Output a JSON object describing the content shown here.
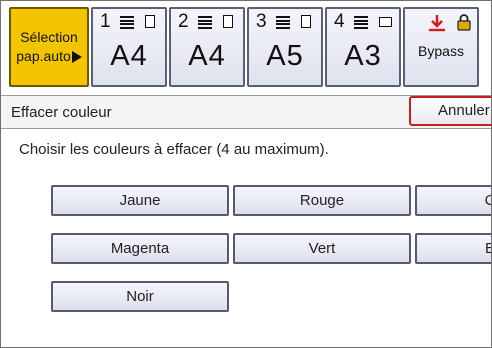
{
  "trays": {
    "auto": {
      "line1": "Sélection",
      "line2": "pap.auto"
    },
    "tray1": {
      "number": "1",
      "size": "A4"
    },
    "tray2": {
      "number": "2",
      "size": "A4"
    },
    "tray3": {
      "number": "3",
      "size": "A5"
    },
    "tray4": {
      "number": "4",
      "size": "A3"
    },
    "bypass": {
      "label": "Bypass"
    }
  },
  "panel": {
    "title": "Effacer couleur",
    "cancel_label": "Annuler",
    "instruction": "Choisir les couleurs à effacer (4 au maximum)."
  },
  "colors": {
    "jaune": "Jaune",
    "rouge": "Rouge",
    "c_partial": "C",
    "magenta": "Magenta",
    "vert": "Vert",
    "b_partial": "B",
    "noir": "Noir"
  },
  "accent": {
    "selected_tray": "#f3c500",
    "cancel_border": "#c81e1e",
    "bypass_arrow": "#d21a1a",
    "lock": "#e0a800"
  }
}
